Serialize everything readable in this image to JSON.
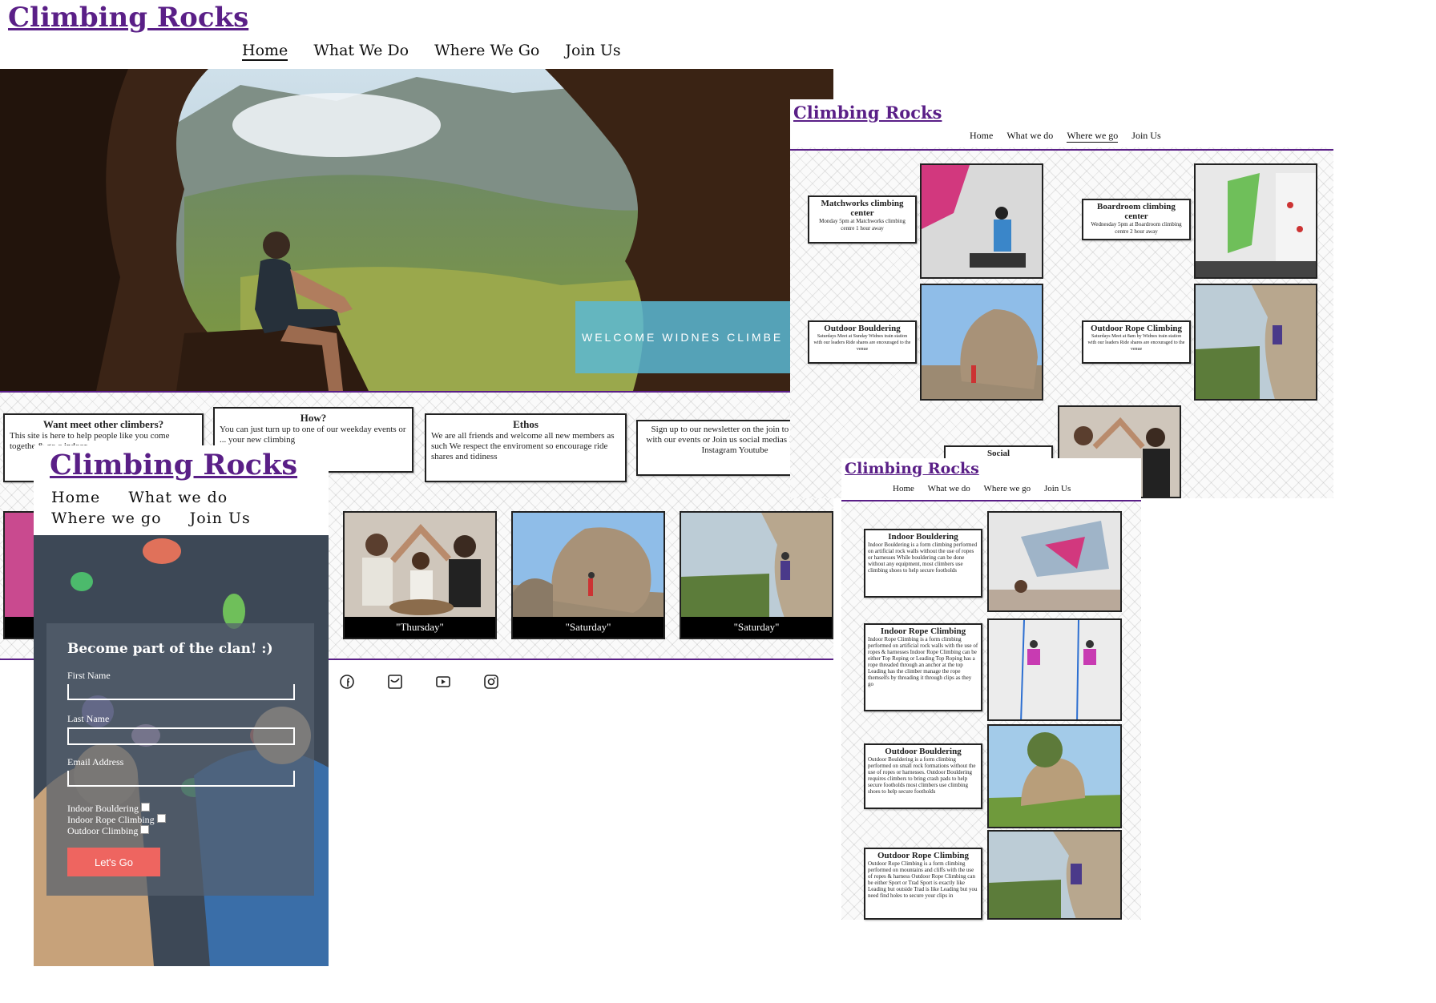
{
  "main_site": {
    "logo": "Climbing Rocks",
    "nav": [
      "Home",
      "What We Do",
      "Where We Go",
      "Join Us"
    ],
    "hero_banner": "WELCOME WIDNES CLIMBE",
    "info_cards": [
      {
        "title": "Want meet other climbers?",
        "body": "This site is here to help people like you come togethe & go c indoor"
      },
      {
        "title": "How?",
        "body": "You can just turn up to one of our weekday events or ... your new climbing"
      },
      {
        "title": "Ethos",
        "body": "We are all friends and welcome all new members as such We respect the enviroment so encourage ride shares and tidiness"
      },
      {
        "title": "",
        "body": "Sign up to our newsletter on the join to keep up with our events or Join us social medias Facebook Instagram Youtube"
      }
    ],
    "gallery_captions": [
      "\"Thursday\"",
      "\"Saturday\"",
      "\"Saturday\""
    ],
    "social_icons": [
      "facebook-icon",
      "twitter-icon",
      "youtube-icon",
      "instagram-icon"
    ]
  },
  "where_page": {
    "logo": "Climbing Rocks",
    "nav": [
      "Home",
      "What we do",
      "Where we go",
      "Join Us"
    ],
    "locations": [
      {
        "title": "Matchworks climbing center",
        "body": "Monday 5pm at Matchworks climbing centre 1 hour away"
      },
      {
        "title": "Boardroom climbing center",
        "body": "Wednesday 5pm at Boardroom climbing centre 2 hour away"
      },
      {
        "title": "Outdoor Bouldering",
        "body": "Saturdays Meet at Sunday Widnes train station with our leaders Ride shares are encouraged to the venue"
      },
      {
        "title": "Outdoor Rope Climbing",
        "body": "Saturdays Meet at 8am by Widnes train station with our leaders Ride shares are encouraged to the venue"
      }
    ],
    "social_label": "Social"
  },
  "what_page": {
    "logo": "Climbing Rocks",
    "nav": [
      "Home",
      "What we do",
      "Where we go",
      "Join Us"
    ],
    "activities": [
      {
        "title": "Indoor Bouldering",
        "body": "Indoor Bouldering is a form climbing performed on artificial rock walls without the use of ropes or harnesses While bouldering can be done without any equipment, most climbers use climbing shoes to help secure footholds"
      },
      {
        "title": "Indoor Rope Climbing",
        "body": "Indoor Rope Climbing is a form climbing performed on artificial rock walls with the use of ropes & harnesses Indoor Rope Climbing can be either Top Roping or Leading Top Roping has a rope threaded through an anchor at the top Leading has the climber manage the rope themselfs by threading it through clips as they go"
      },
      {
        "title": "Outdoor Bouldering",
        "body": "Outdoor Bouldering is a form climbing performed on small rock formations without the use of ropes or harnesses. Outdoor Bouldering requires climbers to bring crash pads to help secure footholds most climbers use climbing shoes to help secure footholds"
      },
      {
        "title": "Outdoor Rope Climbing",
        "body": "Outdoor Rope Climbing is a form climbing performed on mountains and cliffs with the use of ropes & harness Outdoor Rope Climbing can be either Sport or Trad Sport is exactly like Leading but outside Trad is like Leading but you need find holes to secure your clips in"
      }
    ]
  },
  "join_page": {
    "logo": "Climbing Rocks",
    "nav": [
      "Home",
      "What we do",
      "Where we go",
      "Join Us"
    ],
    "form_title": "Become part of the clan! :)",
    "fields": [
      "First Name",
      "Last Name",
      "Email Address"
    ],
    "checkboxes": [
      "Indoor Bouldering",
      "Indoor Rope Climbing",
      "Outdoor Climbing"
    ],
    "submit": "Let's Go"
  },
  "colors": {
    "brand_purple": "#5a1f87",
    "banner_teal": "#5ab8d3",
    "button_coral": "#ee6560"
  }
}
